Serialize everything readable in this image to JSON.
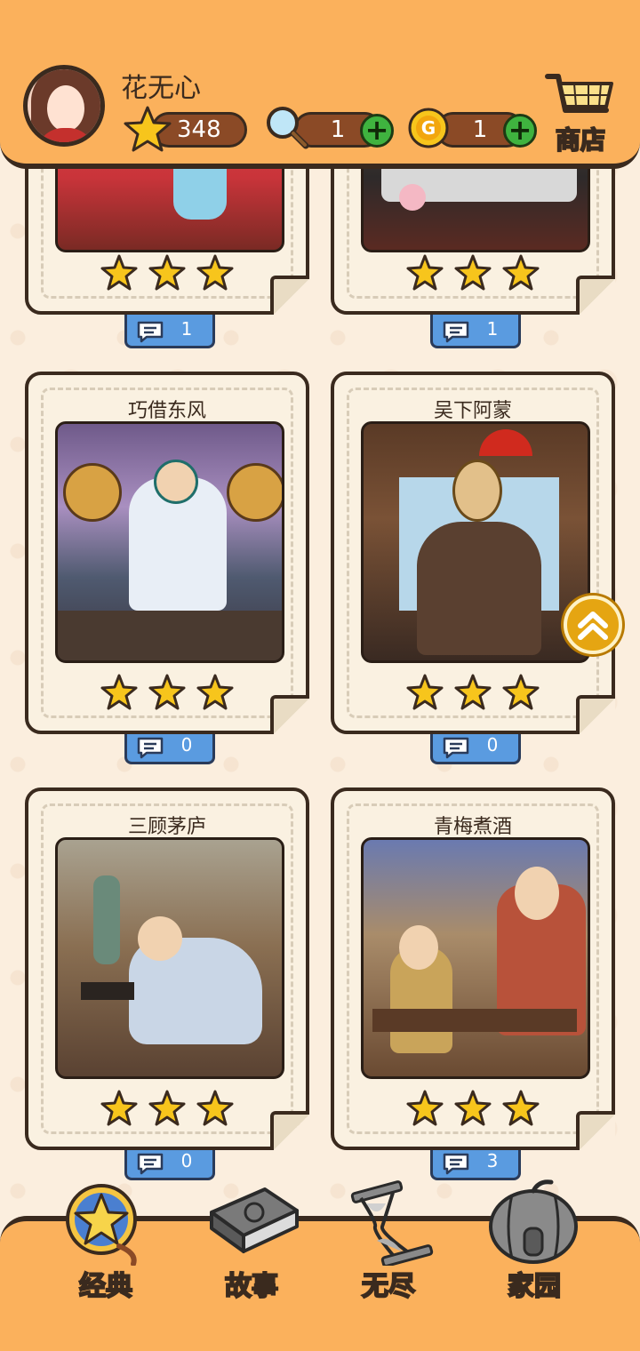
{
  "header": {
    "username": "花无心",
    "stars": "348",
    "magnifiers": "1",
    "coins": "1",
    "shop_label": "商店"
  },
  "cards": [
    {
      "title": "",
      "comments": "1",
      "stars_earned": 3
    },
    {
      "title": "",
      "comments": "1",
      "stars_earned": 3
    },
    {
      "title": "巧借东风",
      "comments": "0",
      "stars_earned": 3
    },
    {
      "title": "吴下阿蒙",
      "comments": "0",
      "stars_earned": 3
    },
    {
      "title": "三顾茅庐",
      "comments": "0",
      "stars_earned": 3
    },
    {
      "title": "青梅煮酒",
      "comments": "3",
      "stars_earned": 3
    }
  ],
  "nav": {
    "items": [
      {
        "label": "经典",
        "icon": "star-medal-icon",
        "active": true
      },
      {
        "label": "故事",
        "icon": "book-icon",
        "active": false
      },
      {
        "label": "无尽",
        "icon": "hourglass-icon",
        "active": false
      },
      {
        "label": "家园",
        "icon": "pumpkin-house-icon",
        "active": false
      }
    ]
  },
  "colors": {
    "header_bg": "#fbb15c",
    "page_bg": "#fbeede",
    "outline": "#3a2a1e",
    "comment_tab": "#5a9be0",
    "star": "#f7c51c"
  }
}
